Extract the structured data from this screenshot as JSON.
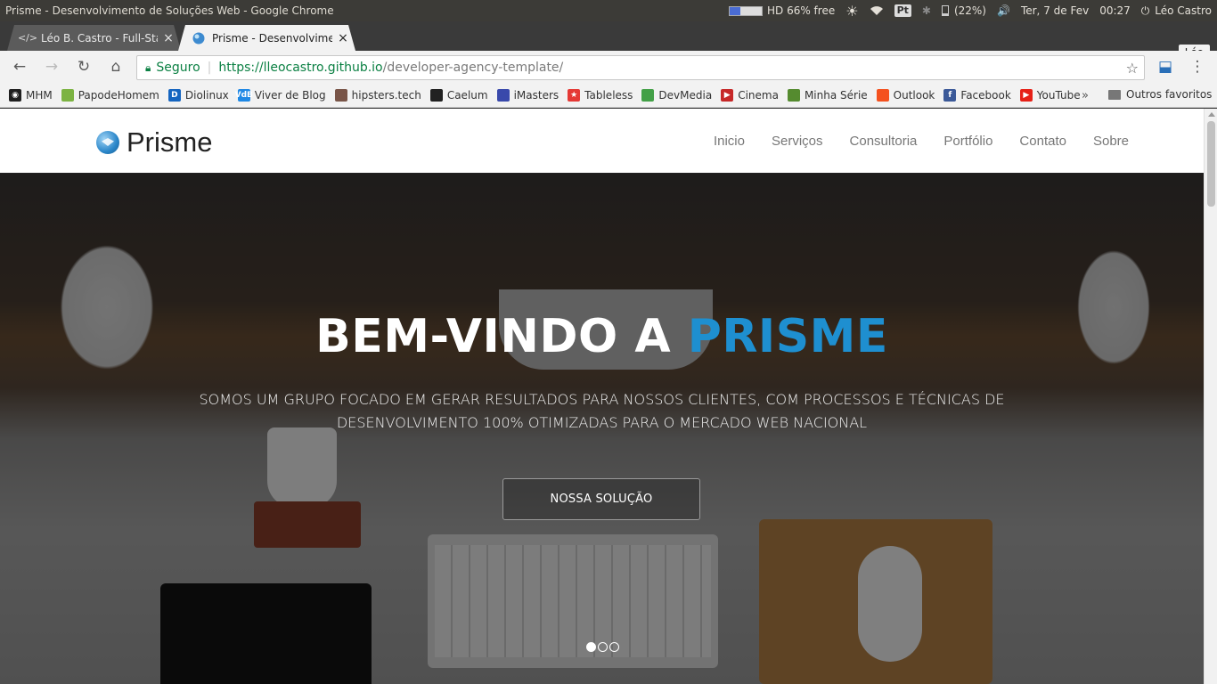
{
  "os": {
    "window_title": "Prisme - Desenvolvimento de Soluções Web - Google Chrome",
    "disk_label": "HD 66% free",
    "disk_free_fraction": 0.66,
    "keyboard_layout": "Pt",
    "battery": "(22%)",
    "datetime": "Ter,  7 de Fev",
    "clock": "00:27",
    "user": "Léo Castro"
  },
  "browser": {
    "tabs": [
      {
        "label": "Léo B. Castro - Full-Stack",
        "favicon": "code-icon",
        "active": false
      },
      {
        "label": "Prisme - Desenvolvimento",
        "favicon": "globe-icon",
        "active": true
      }
    ],
    "profile": "Léo",
    "omnibox": {
      "secure_label": "Seguro",
      "url_host": "https://lleocastro.github.io",
      "url_path": "/developer-agency-template/"
    },
    "bookmarks": [
      {
        "label": "MHM",
        "color": "#1f1f1f",
        "glyph": "◉"
      },
      {
        "label": "PapodeHomem",
        "color": "#7cb342",
        "glyph": ""
      },
      {
        "label": "Diolinux",
        "color": "#1565c0",
        "glyph": "D"
      },
      {
        "label": "Viver de Blog",
        "color": "#1e88e5",
        "glyph": "VdB"
      },
      {
        "label": "hipsters.tech",
        "color": "#795548",
        "glyph": ""
      },
      {
        "label": "Caelum",
        "color": "#212121",
        "glyph": ""
      },
      {
        "label": "iMasters",
        "color": "#3949ab",
        "glyph": ""
      },
      {
        "label": "Tableless",
        "color": "#e53935",
        "glyph": "★"
      },
      {
        "label": "DevMedia",
        "color": "#43a047",
        "glyph": ""
      },
      {
        "label": "Cinema",
        "color": "#c62828",
        "glyph": "▶"
      },
      {
        "label": "Minha Série",
        "color": "#558b2f",
        "glyph": ""
      },
      {
        "label": "Outlook",
        "color": "#f4511e",
        "glyph": ""
      },
      {
        "label": "Facebook",
        "color": "#3b5998",
        "glyph": "f"
      },
      {
        "label": "YouTube",
        "color": "#e62117",
        "glyph": "▶"
      }
    ],
    "bookmarks_more": "»",
    "other_bookmarks": "Outros favoritos"
  },
  "site": {
    "brand": "Prisme",
    "nav": [
      "Inicio",
      "Serviços",
      "Consultoria",
      "Portfólio",
      "Contato",
      "Sobre"
    ],
    "hero": {
      "title_prefix": "BEM-VINDO A ",
      "title_accent": "PRISME",
      "subtitle": "Somos um grupo focado em gerar resultados para nossos clientes, com processos e técnicas de desenvolvimento 100% otimizadas para o mercado web nacional",
      "cta": "NOSSA SOLUÇÃO",
      "slides_total": 3,
      "active_slide": 1
    },
    "accent_color": "#1e8fd0"
  }
}
